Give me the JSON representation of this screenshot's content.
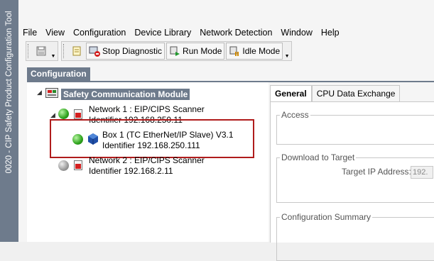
{
  "sidebar": {
    "title": "0020 - CIP Safety Product Configuration Tool"
  },
  "menu": [
    "File",
    "View",
    "Configuration",
    "Device Library",
    "Network Detection",
    "Window",
    "Help"
  ],
  "toolbar": {
    "stop_diagnostic": "Stop Diagnostic",
    "run_mode": "Run Mode",
    "idle_mode": "Idle Mode"
  },
  "panel": {
    "title": "Configuration"
  },
  "tree": {
    "root": "Safety Communication Module",
    "network1": {
      "name": "Network 1 : EIP/CIPS Scanner",
      "identifier": "Identifier 192.168.250.11"
    },
    "box1": {
      "name": "Box 1 (TC EtherNet/IP Slave) V3.1",
      "identifier": "Identifier 192.168.250.111"
    },
    "network2": {
      "name": "Network 2 : EIP/CIPS Scanner",
      "identifier": "Identifier 192.168.2.11"
    }
  },
  "tabs": [
    "General",
    "CPU Data Exchange"
  ],
  "general": {
    "access_title": "Access",
    "download_title": "Download to Target",
    "target_ip_label": "Target IP Address:",
    "target_ip_value": "192.",
    "summary_title": "Configuration Summary"
  },
  "colors": {
    "sidebar": "#6e7b8c",
    "highlight": "#b01c1c"
  }
}
